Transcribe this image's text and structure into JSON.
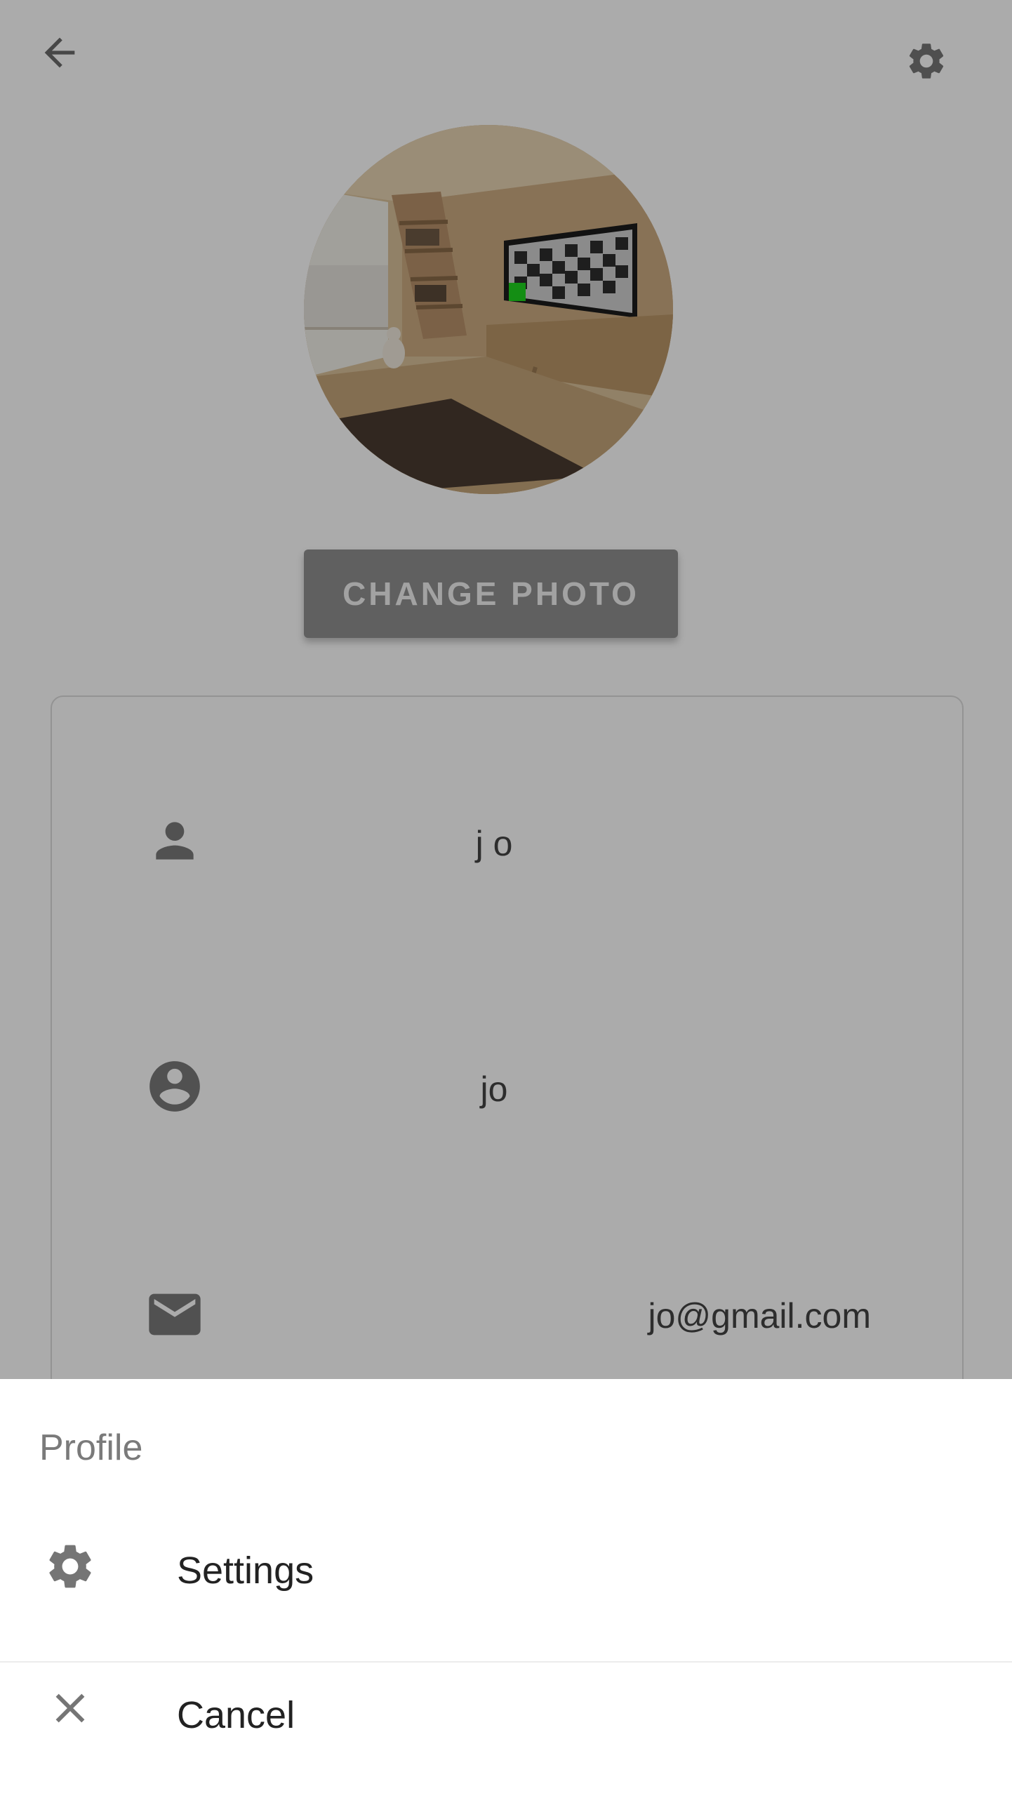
{
  "toolbar": {
    "back_icon": "arrow-left-icon",
    "settings_icon": "gear-icon"
  },
  "profile": {
    "change_photo_label": "CHANGE PHOTO",
    "fields": {
      "name": "j o",
      "username": "jo",
      "email": "jo@gmail.com"
    }
  },
  "sheet": {
    "title": "Profile",
    "items": [
      {
        "label": "Settings",
        "icon": "gear-icon"
      },
      {
        "label": "Cancel",
        "icon": "close-icon"
      }
    ]
  },
  "colors": {
    "scrim": "#000000",
    "button_bg": "#8f8f8f",
    "icon": "#757575"
  }
}
